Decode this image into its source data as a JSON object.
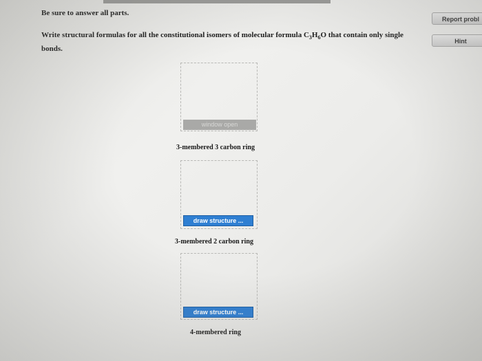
{
  "instructions": "Be sure to answer all parts.",
  "question": {
    "text_before": "Write structural formulas for all the constitutional isomers of molecular formula C",
    "sub_c": "3",
    "mid_h": "H",
    "sub_h": "6",
    "text_after": "O that contain only single bonds."
  },
  "side_buttons": {
    "report_label": "Report probl",
    "hint_label": "Hint"
  },
  "parts": [
    {
      "button_label": "window open",
      "caption": "3-membered 3 carbon ring"
    },
    {
      "button_label": "draw structure ...",
      "caption": "3-membered 2 carbon ring"
    },
    {
      "button_label": "draw structure ...",
      "caption": "4-membered ring"
    }
  ]
}
